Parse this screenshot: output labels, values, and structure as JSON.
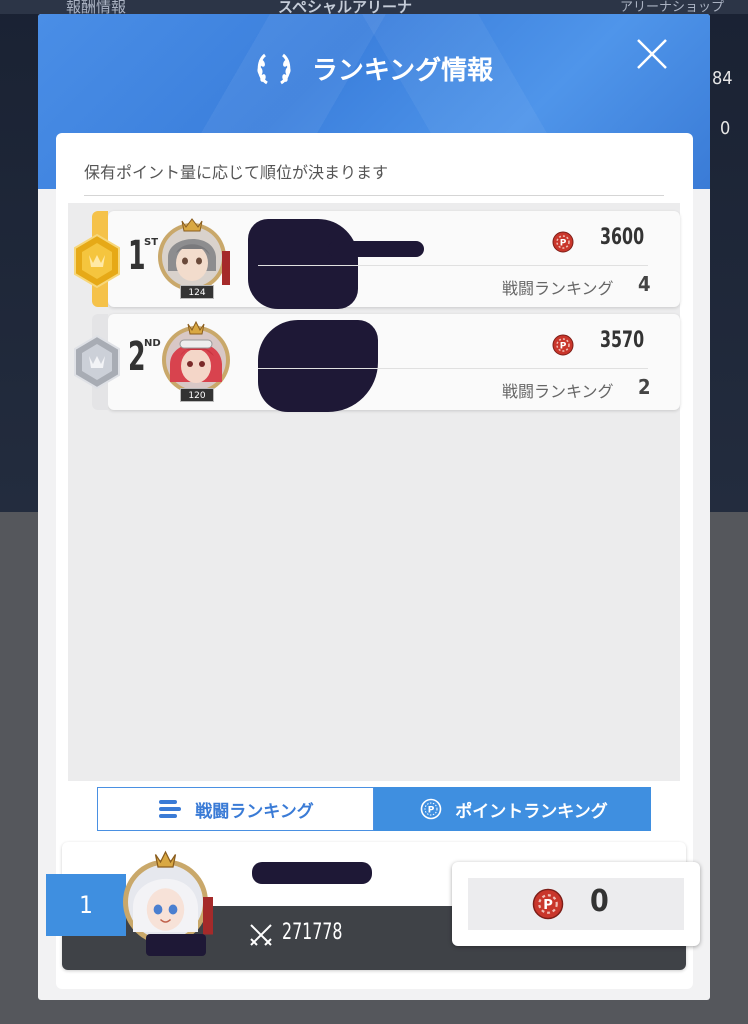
{
  "background": {
    "top_left_label": "報酬情報",
    "top_center_label": "スペシャルアリーナ",
    "top_right_label": "アリーナショップ",
    "side_value_1": "84",
    "side_value_2": "0"
  },
  "modal": {
    "title": "ランキング情報",
    "subtitle": "保有ポイント量に応じて順位が決まります"
  },
  "rankings": [
    {
      "rank": "1",
      "suffix": "ST",
      "level": "124",
      "points": "3600",
      "battle_rank_label": "戦闘ランキング",
      "battle_rank": "4",
      "medal": "gold"
    },
    {
      "rank": "2",
      "suffix": "ND",
      "level": "120",
      "points": "3570",
      "battle_rank_label": "戦闘ランキング",
      "battle_rank": "2",
      "medal": "silver"
    }
  ],
  "tabs": {
    "battle_label": "戦闘ランキング",
    "point_label": "ポイントランキング",
    "active": "point"
  },
  "my_rank": {
    "rank": "1",
    "power": "271778",
    "points": "0"
  },
  "colors": {
    "header_blue": "#3b7fdc",
    "tab_active": "#3f8fe0",
    "gold": "#f5c24a",
    "point_icon": "#c9362b"
  }
}
